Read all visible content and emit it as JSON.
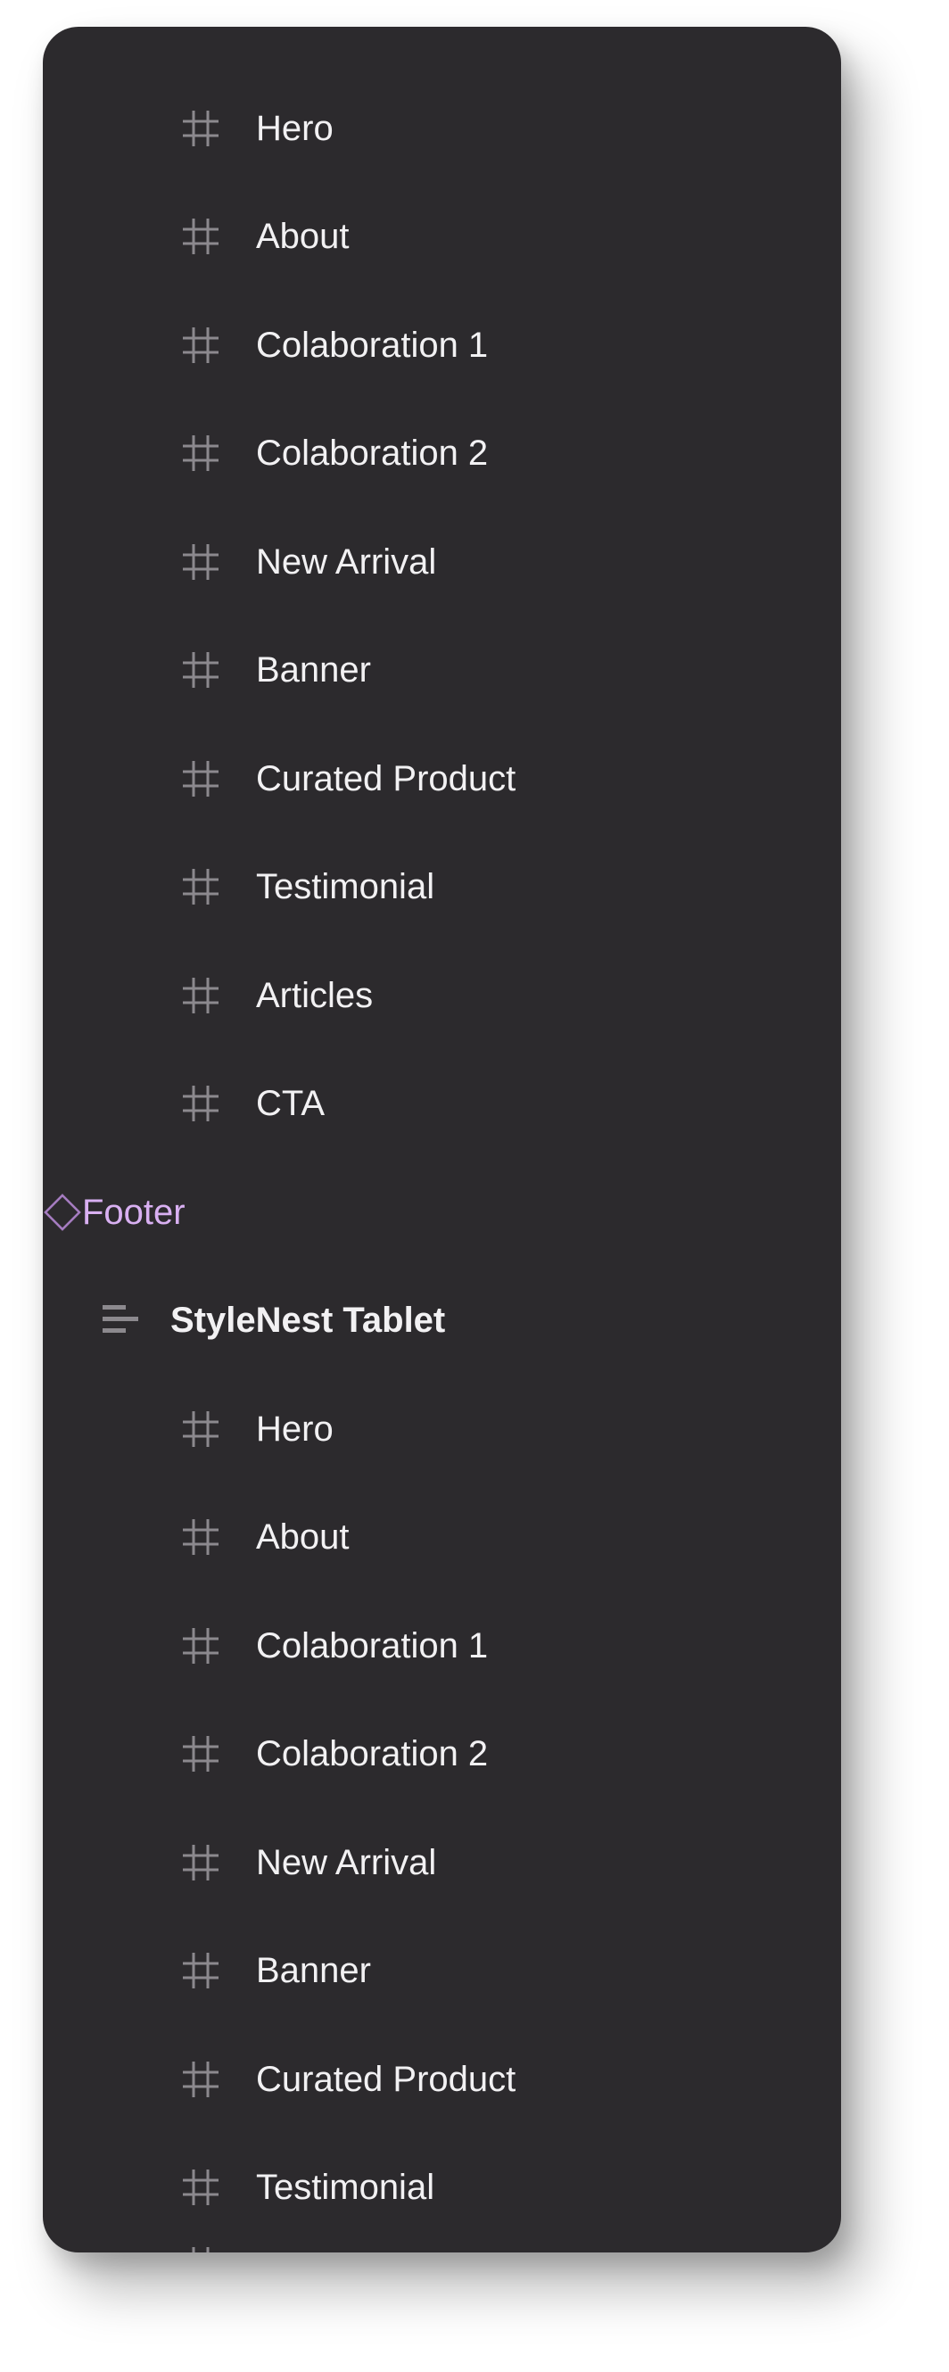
{
  "colors": {
    "panel_bg": "#2c2a2d",
    "text": "#f2f1f3",
    "icon": "#8c898e",
    "component_text": "#d9b0f2",
    "component_icon": "#a57cc0"
  },
  "layers": [
    {
      "label": "Hero",
      "kind": "frame",
      "icon": "hash-icon"
    },
    {
      "label": "About",
      "kind": "frame",
      "icon": "hash-icon"
    },
    {
      "label": "Colaboration 1",
      "kind": "frame",
      "icon": "hash-icon"
    },
    {
      "label": "Colaboration 2",
      "kind": "frame",
      "icon": "hash-icon"
    },
    {
      "label": "New Arrival",
      "kind": "frame",
      "icon": "hash-icon"
    },
    {
      "label": "Banner",
      "kind": "frame",
      "icon": "hash-icon"
    },
    {
      "label": "Curated Product",
      "kind": "frame",
      "icon": "hash-icon"
    },
    {
      "label": "Testimonial",
      "kind": "frame",
      "icon": "hash-icon"
    },
    {
      "label": "Articles",
      "kind": "frame",
      "icon": "hash-icon"
    },
    {
      "label": "CTA",
      "kind": "frame",
      "icon": "hash-icon"
    },
    {
      "label": "Footer",
      "kind": "component",
      "icon": "diamond-icon"
    },
    {
      "label": "StyleNest Tablet",
      "kind": "group",
      "icon": "align-left-icon"
    },
    {
      "label": "Hero",
      "kind": "frame",
      "icon": "hash-icon"
    },
    {
      "label": "About",
      "kind": "frame",
      "icon": "hash-icon"
    },
    {
      "label": "Colaboration 1",
      "kind": "frame",
      "icon": "hash-icon"
    },
    {
      "label": "Colaboration 2",
      "kind": "frame",
      "icon": "hash-icon"
    },
    {
      "label": "New Arrival",
      "kind": "frame",
      "icon": "hash-icon"
    },
    {
      "label": "Banner",
      "kind": "frame",
      "icon": "hash-icon"
    },
    {
      "label": "Curated Product",
      "kind": "frame",
      "icon": "hash-icon"
    },
    {
      "label": "Testimonial",
      "kind": "frame",
      "icon": "hash-icon"
    }
  ]
}
